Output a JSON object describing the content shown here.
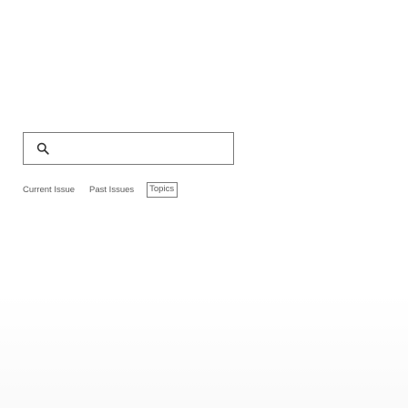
{
  "search": {
    "value": "",
    "placeholder": ""
  },
  "nav": {
    "items": [
      {
        "label": "Current Issue"
      },
      {
        "label": "Past Issues"
      },
      {
        "label": "Topics"
      }
    ]
  },
  "icons": {
    "search": "search-icon"
  },
  "colors": {
    "border": "#7a7a7a",
    "link_text": "#5a5a5a",
    "background": "#ffffff"
  }
}
